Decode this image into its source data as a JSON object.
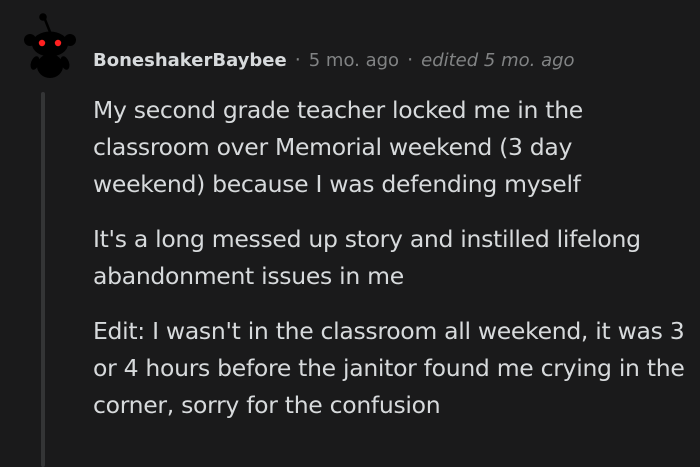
{
  "comment": {
    "author": "BoneshakerBaybee",
    "separator": "·",
    "timestamp": "5 mo. ago",
    "edited": "edited 5 mo. ago",
    "paragraphs": [
      "My second grade teacher locked me in the classroom over Memorial weekend (3 day weekend) because I was defending myself",
      "It's a long messed up story and instilled lifelong abandonment issues in me",
      "Edit: I wasn't in the classroom all weekend, it was 3 or 4 hours before the janitor found me crying in the corner, sorry for the confusion"
    ]
  },
  "colors": {
    "background": "#1a1a1b",
    "text": "#d7dadc",
    "muted": "#818384",
    "thread_line": "#343536",
    "avatar_eyes": "#ff2020"
  },
  "icons": {
    "avatar": "snoo-avatar-icon"
  }
}
